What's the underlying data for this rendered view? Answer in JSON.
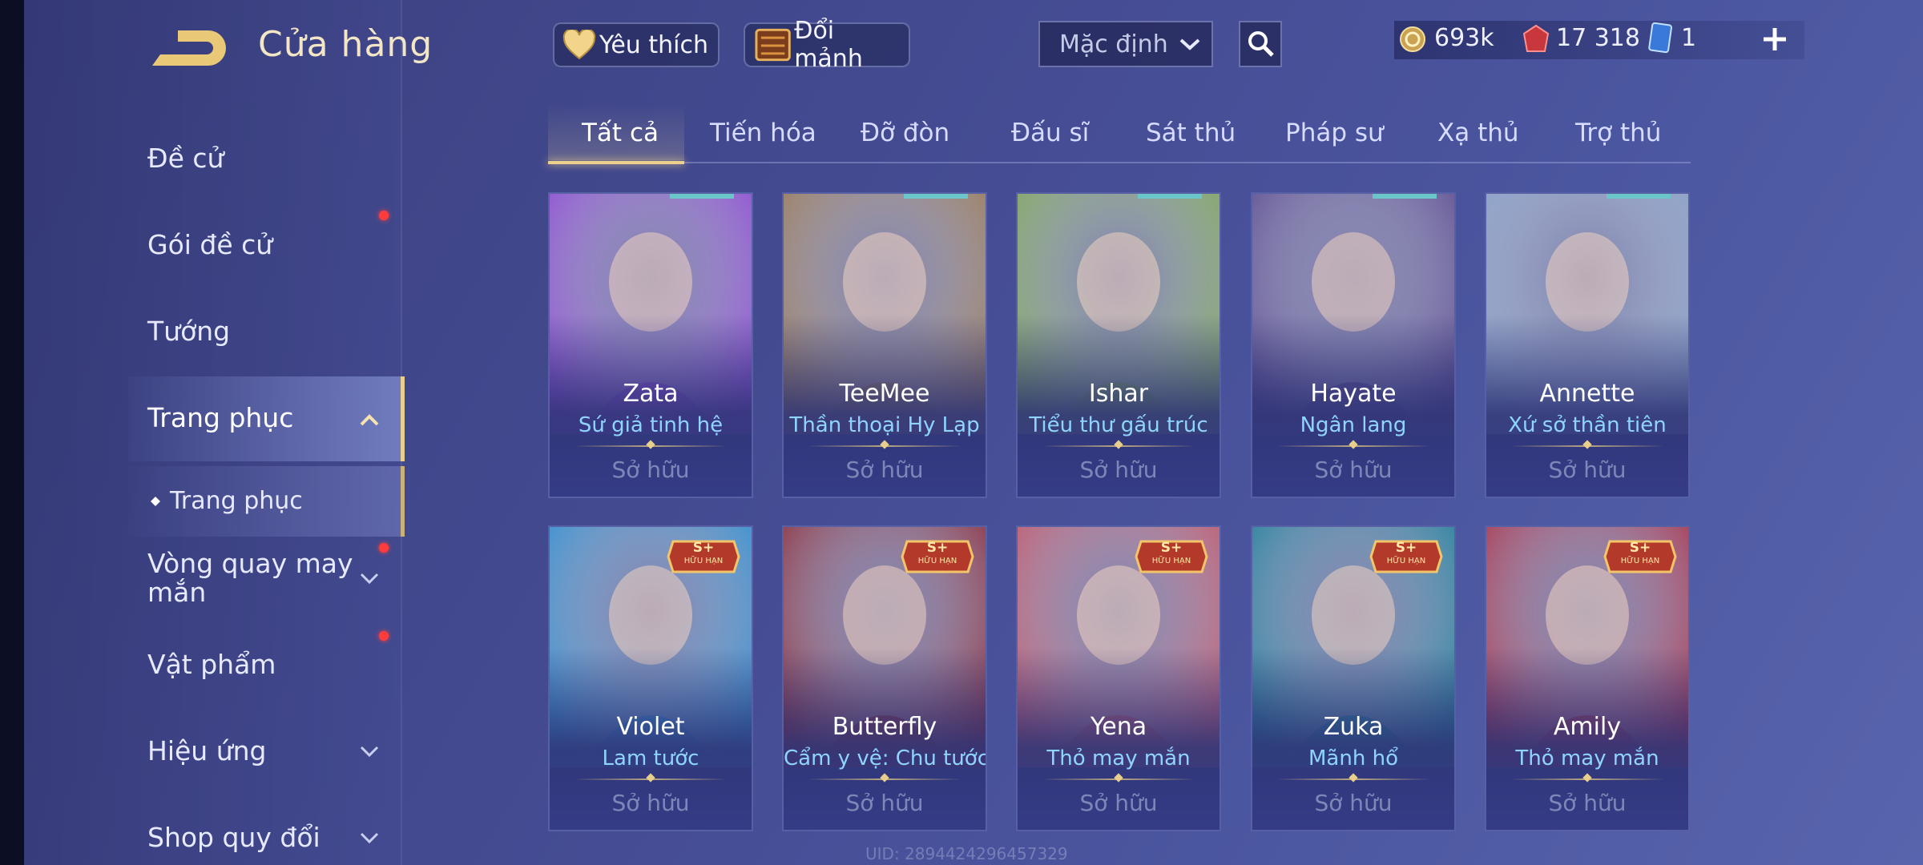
{
  "header": {
    "title": "Cửa hàng",
    "favorite_label": "Yêu thích",
    "exchange_label": "Đổi mảnh",
    "sort_value": "Mặc định",
    "currencies": [
      {
        "icon": "gold-coin-icon",
        "value": "693k"
      },
      {
        "icon": "red-voucher-icon",
        "value": "17 318"
      },
      {
        "icon": "blue-card-icon",
        "value": "1"
      }
    ]
  },
  "sidebar": {
    "items": [
      {
        "label": "Đề cử"
      },
      {
        "label": "Gói đề cử",
        "badge": true
      },
      {
        "label": "Tướng"
      },
      {
        "label": "Trang phục",
        "expanded": true
      },
      {
        "label": "Trang phục",
        "sub": true
      },
      {
        "label": "Vòng quay may mắn",
        "badge": true
      },
      {
        "label": "Vật phẩm",
        "badge": true
      },
      {
        "label": "Hiệu ứng"
      },
      {
        "label": "Shop quy đổi"
      }
    ]
  },
  "tabs": [
    "Tất cả",
    "Tiến hóa",
    "Đỡ đòn",
    "Đấu sĩ",
    "Sát thủ",
    "Pháp sư",
    "Xạ thủ",
    "Trợ thủ"
  ],
  "cards": [
    {
      "hero": "Zata",
      "skin": "Sứ giả tinh hệ",
      "status": "Sở hữu",
      "accent": "#8e49d6"
    },
    {
      "hero": "TeeMee",
      "skin": "Thần thoại Hy Lạp",
      "status": "Sở hữu",
      "accent": "#9b7a55"
    },
    {
      "hero": "Ishar",
      "skin": "Tiểu thư gấu trúc",
      "status": "Sở hữu",
      "accent": "#7fa85a"
    },
    {
      "hero": "Hayate",
      "skin": "Ngân lang",
      "status": "Sở hữu",
      "accent": "#5b4a8f"
    },
    {
      "hero": "Annette",
      "skin": "Xứ sở thần tiên",
      "status": "Sở hữu",
      "accent": "#8aa3c9"
    },
    {
      "hero": "Violet",
      "skin": "Lam tước",
      "status": "Sở hữu",
      "badge": "S+",
      "badge_sub": "HỮU HẠN",
      "accent": "#2e8fd1"
    },
    {
      "hero": "Butterfly",
      "skin": "Cẩm y vệ: Chu tước",
      "status": "Sở hữu",
      "badge": "S+",
      "badge_sub": "HỮU HẠN",
      "accent": "#8a2c3a"
    },
    {
      "hero": "Yena",
      "skin": "Thỏ may mắn",
      "status": "Sở hữu",
      "badge": "S+",
      "badge_sub": "HỮU HẠN",
      "accent": "#c2566a"
    },
    {
      "hero": "Zuka",
      "skin": "Mãnh hổ",
      "status": "Sở hữu",
      "badge": "S+",
      "badge_sub": "HỮU HẠN",
      "accent": "#1e7f9a"
    },
    {
      "hero": "Amily",
      "skin": "Thỏ may mắn",
      "status": "Sở hữu",
      "badge": "S+",
      "badge_sub": "HỮU HẠN",
      "accent": "#a8314b"
    }
  ],
  "uid_text": "UID: 2894424296457329"
}
